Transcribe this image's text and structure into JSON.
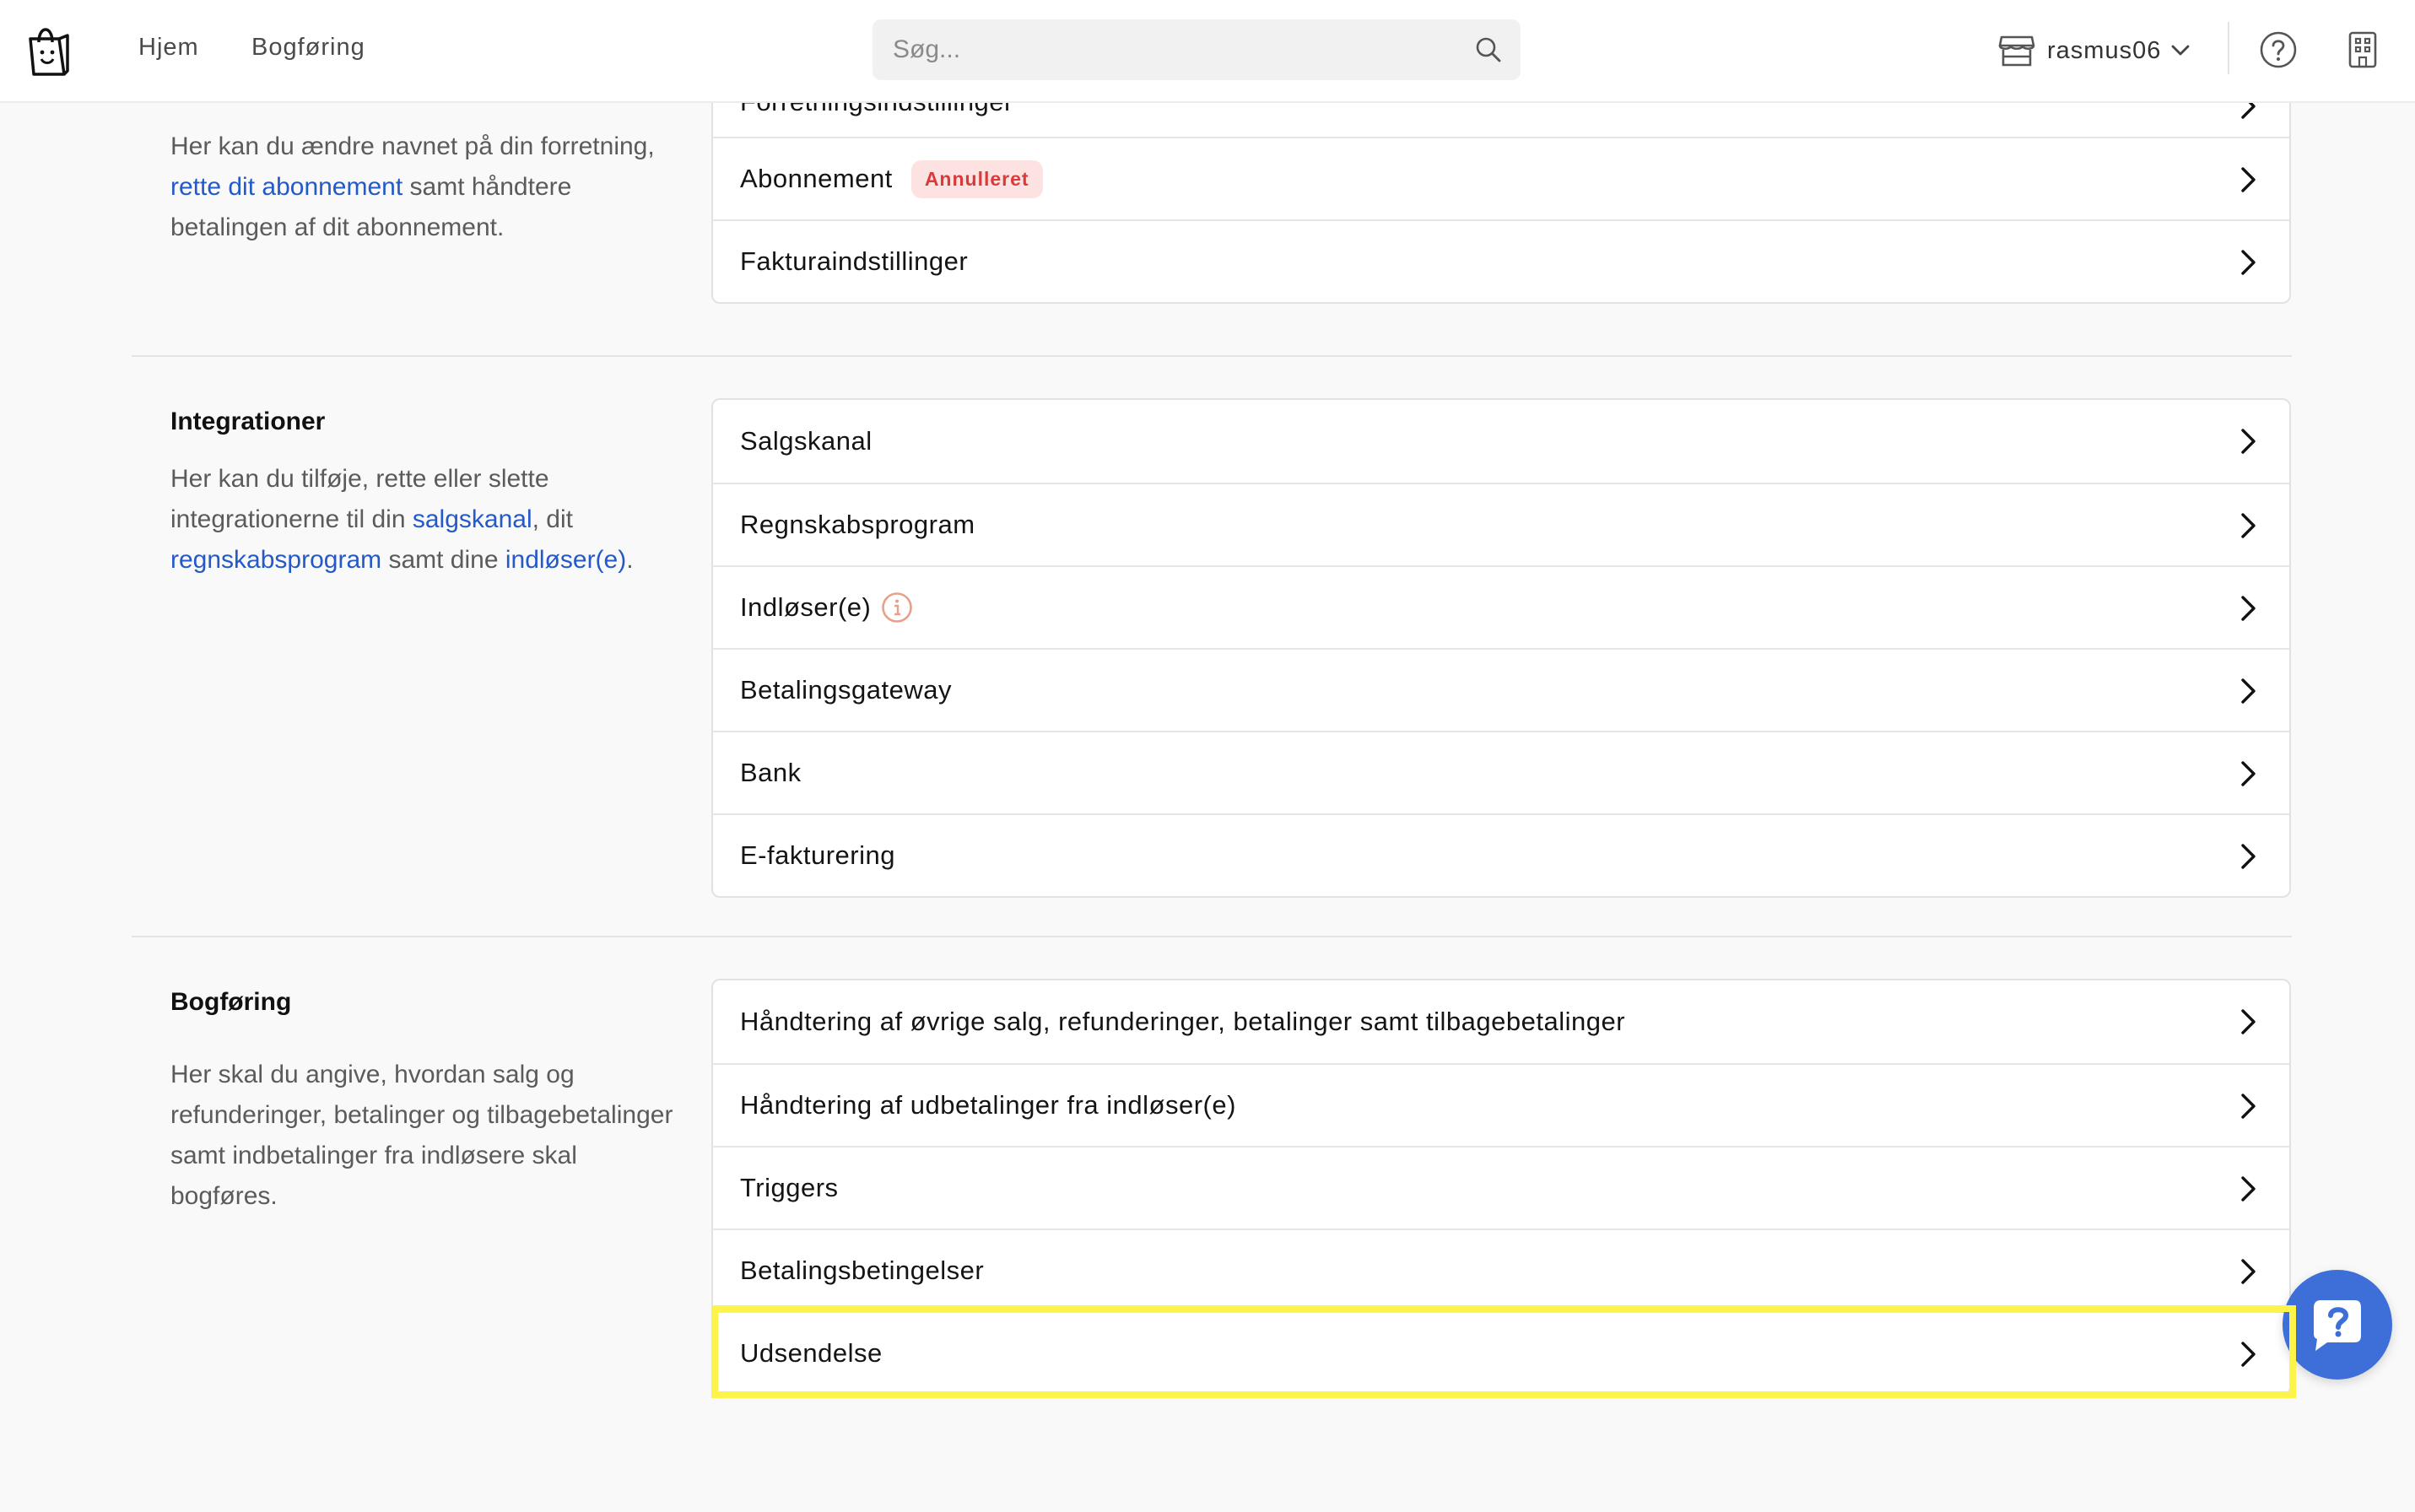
{
  "nav": {
    "links": [
      "Hjem",
      "Bogføring"
    ],
    "search_placeholder": "Søg...",
    "store_label": "rasmus06"
  },
  "sections": {
    "business": {
      "description_parts": [
        "Her kan du ændre navnet på din forretning, ",
        "rette dit abonnement",
        " samt håndtere betalingen af dit abonnement."
      ],
      "rows": [
        "Forretningsindstillinger",
        "Abonnement",
        "Fakturaindstillinger"
      ],
      "badge": "Annulleret"
    },
    "integrations": {
      "title": "Integrationer",
      "description_parts": [
        "Her kan du tilføje, rette eller slette integrationerne til din ",
        "salgskanal",
        ", dit ",
        "regnskabsprogram",
        " samt dine ",
        "indløser(e)",
        "."
      ],
      "rows": [
        "Salgskanal",
        "Regnskabsprogram",
        "Indløser(e)",
        "Betalingsgateway",
        "Bank",
        "E-fakturering"
      ]
    },
    "accounting": {
      "title": "Bogføring",
      "description": "Her skal du angive, hvordan salg og refunderinger, betalinger og tilbagebetalinger samt indbetalinger fra indløsere skal bogføres.",
      "rows": [
        "Håndtering af øvrige salg, refunderinger, betalinger samt tilbagebetalinger",
        "Håndtering af udbetalinger fra indløser(e)",
        "Triggers",
        "Betalingsbetingelser",
        "Udsendelse"
      ]
    }
  },
  "colors": {
    "link": "#2459c8",
    "badge_bg": "#fde2e2",
    "badge_text": "#d93b3b",
    "highlight": "#fdf44a",
    "fab": "#3e6fd8"
  },
  "icons": [
    "shopping-bag-logo-icon",
    "search-icon",
    "store-icon",
    "chevron-down-icon",
    "help-circle-icon",
    "building-icon",
    "chevron-right-icon",
    "info-icon",
    "chat-help-icon"
  ]
}
